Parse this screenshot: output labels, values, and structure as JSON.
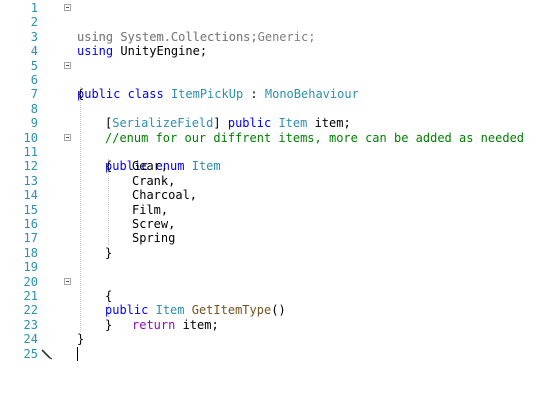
{
  "editor": {
    "line_numbers": [
      "1",
      "2",
      "3",
      "4",
      "5",
      "6",
      "7",
      "8",
      "9",
      "10",
      "11",
      "12",
      "13",
      "14",
      "15",
      "16",
      "17",
      "18",
      "19",
      "20",
      "21",
      "22",
      "23",
      "24",
      "25"
    ],
    "lines": {
      "l1": {
        "kw": "using",
        "rest": " System.Collections;"
      },
      "l2": {
        "kw": "using",
        "rest": " System.Collections.Generic;"
      },
      "l3": {
        "kw": "using",
        "rest": " UnityEngine;"
      },
      "l5": {
        "kw1": "public",
        "kw2": " class ",
        "name": "ItemPickUp",
        "sep": " : ",
        "base": "MonoBehaviour"
      },
      "l6": "{",
      "l8": {
        "open": "[",
        "attr": "SerializeField",
        "close": "] ",
        "kw": "public",
        "sp": " ",
        "type": "Item",
        "rest": " item;"
      },
      "l9": "//enum for our diffrent items, more can be added as needed",
      "l10": {
        "kw1": "public",
        "kw2": " enum ",
        "type": "Item"
      },
      "l11": "{",
      "l12": "Gear,",
      "l13": "Crank,",
      "l14": "Charcoal,",
      "l15": "Film,",
      "l16": "Screw,",
      "l17": "Spring",
      "l18": "}",
      "l20": {
        "kw": "public",
        "sp": " ",
        "type": "Item",
        "sp2": " ",
        "method": "GetItemType",
        "rest": "()"
      },
      "l21": "{",
      "l22": {
        "kw": "return",
        "rest": " item;"
      },
      "l23": "}",
      "l24": "}"
    }
  }
}
